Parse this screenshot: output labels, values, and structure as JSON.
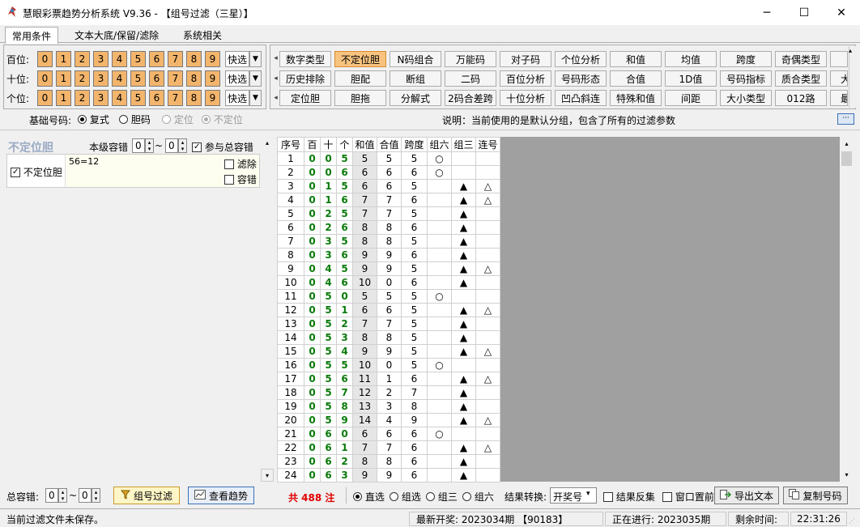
{
  "window": {
    "title": "慧眼彩票趋势分析系统 V9.36 - 【组号过滤（三星）】",
    "minimize": "─",
    "maximize": "☐",
    "close": "✕"
  },
  "tabs": [
    "常用条件",
    "文本大底/保留/滤除",
    "系统相关"
  ],
  "positions": [
    {
      "label": "百位:",
      "digits": [
        "0",
        "1",
        "2",
        "3",
        "4",
        "5",
        "6",
        "7",
        "8",
        "9"
      ],
      "quick": "快选"
    },
    {
      "label": "十位:",
      "digits": [
        "0",
        "1",
        "2",
        "3",
        "4",
        "5",
        "6",
        "7",
        "8",
        "9"
      ],
      "quick": "快选"
    },
    {
      "label": "个位:",
      "digits": [
        "0",
        "1",
        "2",
        "3",
        "4",
        "5",
        "6",
        "7",
        "8",
        "9"
      ],
      "quick": "快选"
    }
  ],
  "conditions": [
    [
      "数字类型",
      "不定位胆",
      "N码组合",
      "万能码",
      "对子码",
      "个位分析",
      "和值",
      "均值",
      "跨度",
      "奇偶类型"
    ],
    [
      "历史排除",
      "胆配",
      "断组",
      "二码",
      "百位分析",
      "号码形态",
      "合值",
      "1D值",
      "号码指标",
      "质合类型"
    ],
    [
      "定位胆",
      "胆拖",
      "分解式",
      "2码合差跨",
      "十位分析",
      "凹凸斜连",
      "特殊和值",
      "间距",
      "大小类型",
      "012路"
    ]
  ],
  "conditions_overflow": [
    "",
    "大",
    "最"
  ],
  "active_condition": "不定位胆",
  "base": {
    "label": "基础号码:",
    "options": [
      {
        "label": "复式",
        "on": true,
        "disabled": false
      },
      {
        "label": "胆码",
        "on": false,
        "disabled": false
      },
      {
        "label": "定位",
        "on": false,
        "disabled": true
      },
      {
        "label": "不定位",
        "on": true,
        "disabled": true
      }
    ],
    "description": "说明：当前使用的是默认分组，包含了所有的过滤参数",
    "more": "···"
  },
  "cond_panel": {
    "title": "不定位胆",
    "tolerance_label": "本级容错",
    "tol_from": "0",
    "tol_sep": "~",
    "tol_to": "0",
    "participate_label": "参与总容错",
    "item_label": "不定位胆",
    "item_value": "56=12",
    "filter_label": "滤除",
    "tolerance_check": "容错"
  },
  "grid": {
    "headers": [
      "序号",
      "百",
      "十",
      "个",
      "和值",
      "合值",
      "跨度",
      "组六",
      "组三",
      "连号"
    ],
    "rows": [
      [
        "1",
        "0",
        "0",
        "5",
        "5",
        "5",
        "5",
        "○",
        "",
        ""
      ],
      [
        "2",
        "0",
        "0",
        "6",
        "6",
        "6",
        "6",
        "○",
        "",
        ""
      ],
      [
        "3",
        "0",
        "1",
        "5",
        "6",
        "6",
        "5",
        "",
        "▲",
        "△"
      ],
      [
        "4",
        "0",
        "1",
        "6",
        "7",
        "7",
        "6",
        "",
        "▲",
        "△"
      ],
      [
        "5",
        "0",
        "2",
        "5",
        "7",
        "7",
        "5",
        "",
        "▲",
        ""
      ],
      [
        "6",
        "0",
        "2",
        "6",
        "8",
        "8",
        "6",
        "",
        "▲",
        ""
      ],
      [
        "7",
        "0",
        "3",
        "5",
        "8",
        "8",
        "5",
        "",
        "▲",
        ""
      ],
      [
        "8",
        "0",
        "3",
        "6",
        "9",
        "9",
        "6",
        "",
        "▲",
        ""
      ],
      [
        "9",
        "0",
        "4",
        "5",
        "9",
        "9",
        "5",
        "",
        "▲",
        "△"
      ],
      [
        "10",
        "0",
        "4",
        "6",
        "10",
        "0",
        "6",
        "",
        "▲",
        ""
      ],
      [
        "11",
        "0",
        "5",
        "0",
        "5",
        "5",
        "5",
        "○",
        "",
        ""
      ],
      [
        "12",
        "0",
        "5",
        "1",
        "6",
        "6",
        "5",
        "",
        "▲",
        "△"
      ],
      [
        "13",
        "0",
        "5",
        "2",
        "7",
        "7",
        "5",
        "",
        "▲",
        ""
      ],
      [
        "14",
        "0",
        "5",
        "3",
        "8",
        "8",
        "5",
        "",
        "▲",
        ""
      ],
      [
        "15",
        "0",
        "5",
        "4",
        "9",
        "9",
        "5",
        "",
        "▲",
        "△"
      ],
      [
        "16",
        "0",
        "5",
        "5",
        "10",
        "0",
        "5",
        "○",
        "",
        ""
      ],
      [
        "17",
        "0",
        "5",
        "6",
        "11",
        "1",
        "6",
        "",
        "▲",
        "△"
      ],
      [
        "18",
        "0",
        "5",
        "7",
        "12",
        "2",
        "7",
        "",
        "▲",
        ""
      ],
      [
        "19",
        "0",
        "5",
        "8",
        "13",
        "3",
        "8",
        "",
        "▲",
        ""
      ],
      [
        "20",
        "0",
        "5",
        "9",
        "14",
        "4",
        "9",
        "",
        "▲",
        "△"
      ],
      [
        "21",
        "0",
        "6",
        "0",
        "6",
        "6",
        "6",
        "○",
        "",
        ""
      ],
      [
        "22",
        "0",
        "6",
        "1",
        "7",
        "7",
        "6",
        "",
        "▲",
        "△"
      ],
      [
        "23",
        "0",
        "6",
        "2",
        "8",
        "8",
        "6",
        "",
        "▲",
        ""
      ],
      [
        "24",
        "0",
        "6",
        "3",
        "9",
        "9",
        "6",
        "",
        "▲",
        ""
      ]
    ]
  },
  "bottom": {
    "total_tol_label": "总容错:",
    "tol_from": "0",
    "tol_sep": "~",
    "tol_to": "0",
    "filter_button": "组号过滤",
    "trend_button": "查看趋势",
    "count": "共 488 注",
    "play_modes": [
      {
        "label": "直选",
        "on": true
      },
      {
        "label": "组选",
        "on": false
      },
      {
        "label": "组三",
        "on": false
      },
      {
        "label": "组六",
        "on": false
      }
    ],
    "convert_label": "结果转换:",
    "convert_value": "开奖号",
    "invert_label": "结果反集",
    "pin_label": "窗口置前",
    "export_button": "导出文本",
    "copy_button": "复制号码"
  },
  "status": {
    "save_state": "当前过滤文件未保存。",
    "latest": "最新开奖: 2023034期 【90183】",
    "running": "正在进行: 2023035期",
    "remaining_label": "剩余时间:",
    "time": "22:31:26"
  }
}
